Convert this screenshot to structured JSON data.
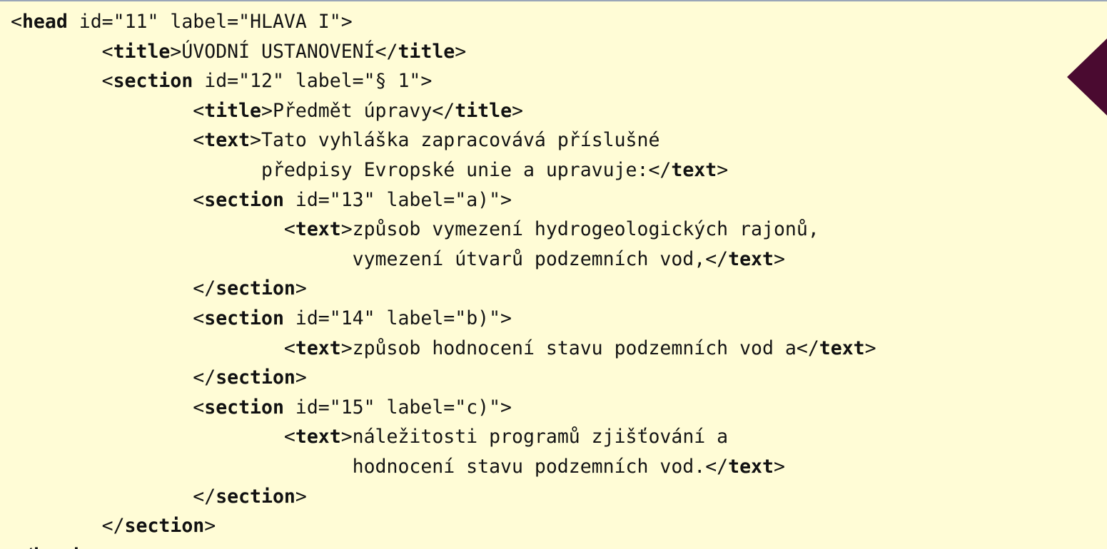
{
  "colors": {
    "background": "#fffcd6",
    "text": "#141414",
    "marker": "#4a0a30",
    "top_border": "#9aa6b8"
  },
  "marker_icon": "triangle-left-icon",
  "lines": [
    [
      "<",
      {
        "t": "head"
      },
      " id=\"11\" label=\"HLAVA I\">"
    ],
    [
      "        <",
      {
        "t": "title"
      },
      ">ÚVODNÍ USTANOVENÍ</",
      {
        "t": "title"
      },
      ">"
    ],
    [
      "        <",
      {
        "t": "section"
      },
      " id=\"12\" label=\"§ 1\">"
    ],
    [
      "                <",
      {
        "t": "title"
      },
      ">Předmět úpravy</",
      {
        "t": "title"
      },
      ">"
    ],
    [
      "                <",
      {
        "t": "text"
      },
      ">Tato vyhláška zapracovává příslušné"
    ],
    [
      "                      předpisy Evropské unie a upravuje:</",
      {
        "t": "text"
      },
      ">"
    ],
    [
      "                <",
      {
        "t": "section"
      },
      " id=\"13\" label=\"a)\">"
    ],
    [
      "                        <",
      {
        "t": "text"
      },
      ">způsob vymezení hydrogeologických rajonů,"
    ],
    [
      "                              vymezení útvarů podzemních vod,</",
      {
        "t": "text"
      },
      ">"
    ],
    [
      "                </",
      {
        "t": "section"
      },
      ">"
    ],
    [
      "                <",
      {
        "t": "section"
      },
      " id=\"14\" label=\"b)\">"
    ],
    [
      "                        <",
      {
        "t": "text"
      },
      ">způsob hodnocení stavu podzemních vod a</",
      {
        "t": "text"
      },
      ">"
    ],
    [
      "                </",
      {
        "t": "section"
      },
      ">"
    ],
    [
      "                <",
      {
        "t": "section"
      },
      " id=\"15\" label=\"c)\">"
    ],
    [
      "                        <",
      {
        "t": "text"
      },
      ">náležitosti programů zjišťování a"
    ],
    [
      "                              hodnocení stavu podzemních vod.</",
      {
        "t": "text"
      },
      ">"
    ],
    [
      "                </",
      {
        "t": "section"
      },
      ">"
    ],
    [
      "        </",
      {
        "t": "section"
      },
      ">"
    ],
    [
      "</",
      {
        "t": "head"
      },
      ">"
    ]
  ]
}
